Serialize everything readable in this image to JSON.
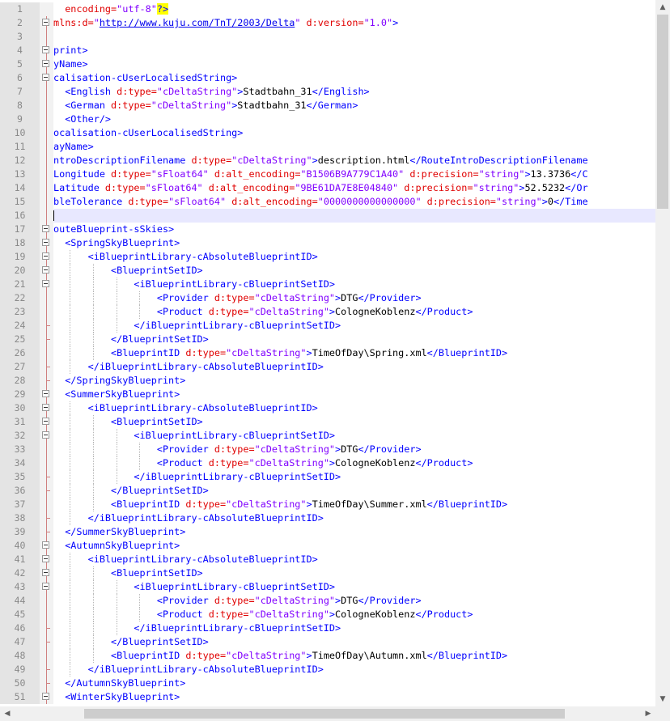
{
  "editor": {
    "current_line": 16,
    "lines": [
      {
        "n": "1",
        "fold": "none",
        "segs": [
          [
            "  encoding=",
            "attr"
          ],
          [
            "\"utf-8\"",
            "val"
          ],
          [
            "?>",
            "hl"
          ]
        ]
      },
      {
        "n": "2",
        "fold": "box",
        "segs": [
          [
            "mlns:d=",
            "attr"
          ],
          [
            "\"",
            "val"
          ],
          [
            "http://www.kuju.com/TnT/2003/Delta",
            "link"
          ],
          [
            "\"",
            "val"
          ],
          [
            " d:version=",
            "attr"
          ],
          [
            "\"1.0\"",
            "val"
          ],
          [
            ">",
            "tag"
          ]
        ]
      },
      {
        "n": "3",
        "fold": "line",
        "segs": []
      },
      {
        "n": "4",
        "fold": "box",
        "segs": [
          [
            "print>",
            "tag"
          ]
        ]
      },
      {
        "n": "5",
        "fold": "box",
        "segs": [
          [
            "yName>",
            "tag"
          ]
        ]
      },
      {
        "n": "6",
        "fold": "box",
        "segs": [
          [
            "calisation-cUserLocalisedString>",
            "tag"
          ]
        ]
      },
      {
        "n": "7",
        "fold": "line",
        "segs": [
          [
            "  <English ",
            "tag"
          ],
          [
            "d:type=",
            "attr"
          ],
          [
            "\"cDeltaString\"",
            "val"
          ],
          [
            ">",
            "tag"
          ],
          [
            "Stadtbahn_31",
            "text"
          ],
          [
            "</English>",
            "tag"
          ]
        ]
      },
      {
        "n": "8",
        "fold": "line",
        "segs": [
          [
            "  <German ",
            "tag"
          ],
          [
            "d:type=",
            "attr"
          ],
          [
            "\"cDeltaString\"",
            "val"
          ],
          [
            ">",
            "tag"
          ],
          [
            "Stadtbahn_31",
            "text"
          ],
          [
            "</German>",
            "tag"
          ]
        ]
      },
      {
        "n": "9",
        "fold": "line",
        "segs": [
          [
            "  <Other/>",
            "tag"
          ]
        ]
      },
      {
        "n": "10",
        "fold": "line",
        "segs": [
          [
            "ocalisation-cUserLocalisedString>",
            "tag"
          ]
        ]
      },
      {
        "n": "11",
        "fold": "line",
        "segs": [
          [
            "ayName>",
            "tag"
          ]
        ]
      },
      {
        "n": "12",
        "fold": "line",
        "segs": [
          [
            "ntroDescriptionFilename ",
            "tag"
          ],
          [
            "d:type=",
            "attr"
          ],
          [
            "\"cDeltaString\"",
            "val"
          ],
          [
            ">",
            "tag"
          ],
          [
            "description.html",
            "text"
          ],
          [
            "</RouteIntroDescriptionFilename",
            "tag"
          ]
        ]
      },
      {
        "n": "13",
        "fold": "line",
        "segs": [
          [
            "Longitude ",
            "tag"
          ],
          [
            "d:type=",
            "attr"
          ],
          [
            "\"sFloat64\"",
            "val"
          ],
          [
            " d:alt_encoding=",
            "attr"
          ],
          [
            "\"B1506B9A779C1A40\"",
            "val"
          ],
          [
            " d:precision=",
            "attr"
          ],
          [
            "\"string\"",
            "val"
          ],
          [
            ">",
            "tag"
          ],
          [
            "13.3736",
            "text"
          ],
          [
            "</C",
            "tag"
          ]
        ]
      },
      {
        "n": "14",
        "fold": "line",
        "segs": [
          [
            "Latitude ",
            "tag"
          ],
          [
            "d:type=",
            "attr"
          ],
          [
            "\"sFloat64\"",
            "val"
          ],
          [
            " d:alt_encoding=",
            "attr"
          ],
          [
            "\"9BE61DA7E8E04840\"",
            "val"
          ],
          [
            " d:precision=",
            "attr"
          ],
          [
            "\"string\"",
            "val"
          ],
          [
            ">",
            "tag"
          ],
          [
            "52.5232",
            "text"
          ],
          [
            "</Or",
            "tag"
          ]
        ]
      },
      {
        "n": "15",
        "fold": "line",
        "segs": [
          [
            "bleTolerance ",
            "tag"
          ],
          [
            "d:type=",
            "attr"
          ],
          [
            "\"sFloat64\"",
            "val"
          ],
          [
            " d:alt_encoding=",
            "attr"
          ],
          [
            "\"0000000000000000\"",
            "val"
          ],
          [
            " d:precision=",
            "attr"
          ],
          [
            "\"string\"",
            "val"
          ],
          [
            ">",
            "tag"
          ],
          [
            "0",
            "text"
          ],
          [
            "</Time",
            "tag"
          ]
        ]
      },
      {
        "n": "16",
        "fold": "line",
        "segs": []
      },
      {
        "n": "17",
        "fold": "box",
        "segs": [
          [
            "outeBlueprint-sSkies>",
            "tag"
          ]
        ]
      },
      {
        "n": "18",
        "fold": "box",
        "segs": [
          [
            "  <SpringSkyBlueprint>",
            "tag"
          ]
        ]
      },
      {
        "n": "19",
        "fold": "box",
        "segs": [
          [
            "      <iBlueprintLibrary-cAbsoluteBlueprintID>",
            "tag"
          ]
        ]
      },
      {
        "n": "20",
        "fold": "box",
        "segs": [
          [
            "          <BlueprintSetID>",
            "tag"
          ]
        ]
      },
      {
        "n": "21",
        "fold": "box",
        "segs": [
          [
            "              <iBlueprintLibrary-cBlueprintSetID>",
            "tag"
          ]
        ]
      },
      {
        "n": "22",
        "fold": "line",
        "segs": [
          [
            "                  <Provider ",
            "tag"
          ],
          [
            "d:type=",
            "attr"
          ],
          [
            "\"cDeltaString\"",
            "val"
          ],
          [
            ">",
            "tag"
          ],
          [
            "DTG",
            "text"
          ],
          [
            "</Provider>",
            "tag"
          ]
        ]
      },
      {
        "n": "23",
        "fold": "line",
        "segs": [
          [
            "                  <Product ",
            "tag"
          ],
          [
            "d:type=",
            "attr"
          ],
          [
            "\"cDeltaString\"",
            "val"
          ],
          [
            ">",
            "tag"
          ],
          [
            "CologneKoblenz",
            "text"
          ],
          [
            "</Product>",
            "tag"
          ]
        ]
      },
      {
        "n": "24",
        "fold": "tick",
        "segs": [
          [
            "              </iBlueprintLibrary-cBlueprintSetID>",
            "tag"
          ]
        ]
      },
      {
        "n": "25",
        "fold": "tick",
        "segs": [
          [
            "          </BlueprintSetID>",
            "tag"
          ]
        ]
      },
      {
        "n": "26",
        "fold": "line",
        "segs": [
          [
            "          <BlueprintID ",
            "tag"
          ],
          [
            "d:type=",
            "attr"
          ],
          [
            "\"cDeltaString\"",
            "val"
          ],
          [
            ">",
            "tag"
          ],
          [
            "TimeOfDay\\Spring.xml",
            "text"
          ],
          [
            "</BlueprintID>",
            "tag"
          ]
        ]
      },
      {
        "n": "27",
        "fold": "tick",
        "segs": [
          [
            "      </iBlueprintLibrary-cAbsoluteBlueprintID>",
            "tag"
          ]
        ]
      },
      {
        "n": "28",
        "fold": "tick",
        "segs": [
          [
            "  </SpringSkyBlueprint>",
            "tag"
          ]
        ]
      },
      {
        "n": "29",
        "fold": "box",
        "segs": [
          [
            "  <SummerSkyBlueprint>",
            "tag"
          ]
        ]
      },
      {
        "n": "30",
        "fold": "box",
        "segs": [
          [
            "      <iBlueprintLibrary-cAbsoluteBlueprintID>",
            "tag"
          ]
        ]
      },
      {
        "n": "31",
        "fold": "box",
        "segs": [
          [
            "          <BlueprintSetID>",
            "tag"
          ]
        ]
      },
      {
        "n": "32",
        "fold": "box",
        "segs": [
          [
            "              <iBlueprintLibrary-cBlueprintSetID>",
            "tag"
          ]
        ]
      },
      {
        "n": "33",
        "fold": "line",
        "segs": [
          [
            "                  <Provider ",
            "tag"
          ],
          [
            "d:type=",
            "attr"
          ],
          [
            "\"cDeltaString\"",
            "val"
          ],
          [
            ">",
            "tag"
          ],
          [
            "DTG",
            "text"
          ],
          [
            "</Provider>",
            "tag"
          ]
        ]
      },
      {
        "n": "34",
        "fold": "line",
        "segs": [
          [
            "                  <Product ",
            "tag"
          ],
          [
            "d:type=",
            "attr"
          ],
          [
            "\"cDeltaString\"",
            "val"
          ],
          [
            ">",
            "tag"
          ],
          [
            "CologneKoblenz",
            "text"
          ],
          [
            "</Product>",
            "tag"
          ]
        ]
      },
      {
        "n": "35",
        "fold": "tick",
        "segs": [
          [
            "              </iBlueprintLibrary-cBlueprintSetID>",
            "tag"
          ]
        ]
      },
      {
        "n": "36",
        "fold": "tick",
        "segs": [
          [
            "          </BlueprintSetID>",
            "tag"
          ]
        ]
      },
      {
        "n": "37",
        "fold": "line",
        "segs": [
          [
            "          <BlueprintID ",
            "tag"
          ],
          [
            "d:type=",
            "attr"
          ],
          [
            "\"cDeltaString\"",
            "val"
          ],
          [
            ">",
            "tag"
          ],
          [
            "TimeOfDay\\Summer.xml",
            "text"
          ],
          [
            "</BlueprintID>",
            "tag"
          ]
        ]
      },
      {
        "n": "38",
        "fold": "tick",
        "segs": [
          [
            "      </iBlueprintLibrary-cAbsoluteBlueprintID>",
            "tag"
          ]
        ]
      },
      {
        "n": "39",
        "fold": "tick",
        "segs": [
          [
            "  </SummerSkyBlueprint>",
            "tag"
          ]
        ]
      },
      {
        "n": "40",
        "fold": "box",
        "segs": [
          [
            "  <AutumnSkyBlueprint>",
            "tag"
          ]
        ]
      },
      {
        "n": "41",
        "fold": "box",
        "segs": [
          [
            "      <iBlueprintLibrary-cAbsoluteBlueprintID>",
            "tag"
          ]
        ]
      },
      {
        "n": "42",
        "fold": "box",
        "segs": [
          [
            "          <BlueprintSetID>",
            "tag"
          ]
        ]
      },
      {
        "n": "43",
        "fold": "box",
        "segs": [
          [
            "              <iBlueprintLibrary-cBlueprintSetID>",
            "tag"
          ]
        ]
      },
      {
        "n": "44",
        "fold": "line",
        "segs": [
          [
            "                  <Provider ",
            "tag"
          ],
          [
            "d:type=",
            "attr"
          ],
          [
            "\"cDeltaString\"",
            "val"
          ],
          [
            ">",
            "tag"
          ],
          [
            "DTG",
            "text"
          ],
          [
            "</Provider>",
            "tag"
          ]
        ]
      },
      {
        "n": "45",
        "fold": "line",
        "segs": [
          [
            "                  <Product ",
            "tag"
          ],
          [
            "d:type=",
            "attr"
          ],
          [
            "\"cDeltaString\"",
            "val"
          ],
          [
            ">",
            "tag"
          ],
          [
            "CologneKoblenz",
            "text"
          ],
          [
            "</Product>",
            "tag"
          ]
        ]
      },
      {
        "n": "46",
        "fold": "tick",
        "segs": [
          [
            "              </iBlueprintLibrary-cBlueprintSetID>",
            "tag"
          ]
        ]
      },
      {
        "n": "47",
        "fold": "tick",
        "segs": [
          [
            "          </BlueprintSetID>",
            "tag"
          ]
        ]
      },
      {
        "n": "48",
        "fold": "line",
        "segs": [
          [
            "          <BlueprintID ",
            "tag"
          ],
          [
            "d:type=",
            "attr"
          ],
          [
            "\"cDeltaString\"",
            "val"
          ],
          [
            ">",
            "tag"
          ],
          [
            "TimeOfDay\\Autumn.xml",
            "text"
          ],
          [
            "</BlueprintID>",
            "tag"
          ]
        ]
      },
      {
        "n": "49",
        "fold": "tick",
        "segs": [
          [
            "      </iBlueprintLibrary-cAbsoluteBlueprintID>",
            "tag"
          ]
        ]
      },
      {
        "n": "50",
        "fold": "tick",
        "segs": [
          [
            "  </AutumnSkyBlueprint>",
            "tag"
          ]
        ]
      },
      {
        "n": "51",
        "fold": "box",
        "segs": [
          [
            "  <WinterSkyBlueprint>",
            "tag"
          ]
        ]
      }
    ]
  },
  "scrollbars": {
    "up_icon": "arrow-up-icon",
    "down_icon": "arrow-down-icon",
    "left_icon": "arrow-left-icon",
    "right_icon": "arrow-right-icon"
  }
}
